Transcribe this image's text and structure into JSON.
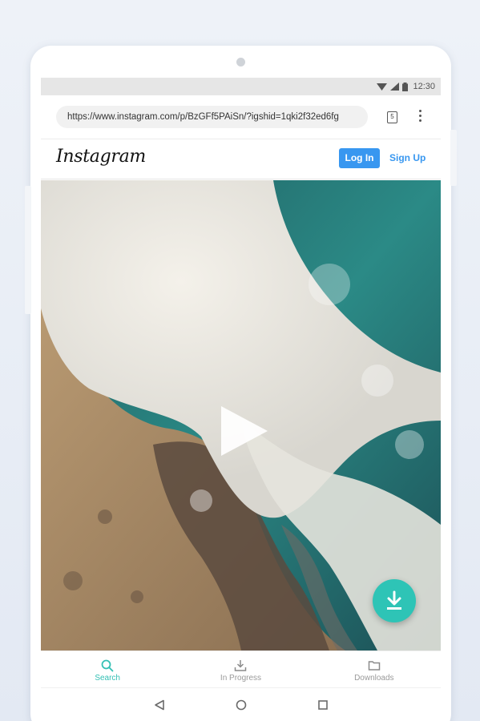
{
  "status_bar": {
    "time": "12:30"
  },
  "browser": {
    "url": "https://www.instagram.com/p/BzGFf5PAiSn/?igshid=1qki2f32ed6fg",
    "tab_count": "5"
  },
  "instagram": {
    "logo_text": "Instagram",
    "login_label": "Log In",
    "signup_label": "Sign Up"
  },
  "colors": {
    "accent_teal": "#34c0b4",
    "instagram_blue": "#3897f0",
    "fab": "#2ec4b6"
  },
  "bottom_nav": {
    "items": [
      {
        "label": "Search",
        "icon": "search-icon",
        "active": true
      },
      {
        "label": "In Progress",
        "icon": "download-tray-icon",
        "active": false
      },
      {
        "label": "Downloads",
        "icon": "folder-icon",
        "active": false
      }
    ]
  },
  "system_nav": {
    "icons": [
      "back-icon",
      "home-icon",
      "recents-icon"
    ]
  }
}
